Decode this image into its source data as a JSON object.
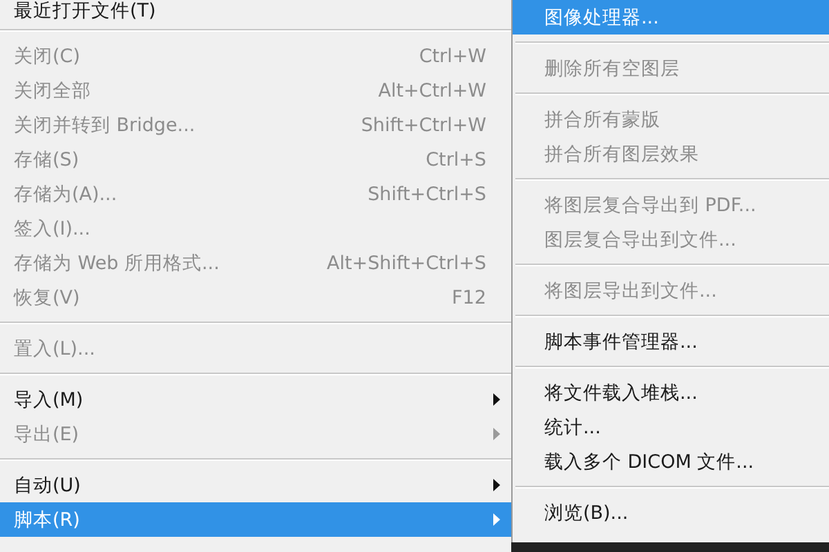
{
  "file_menu": {
    "items": [
      {
        "kind": "item",
        "label": "最近打开文件(T)",
        "disabled": false,
        "selected": false,
        "submenu": false
      },
      {
        "kind": "separator"
      },
      {
        "kind": "item",
        "label": "关闭(C)",
        "shortcut": "Ctrl+W",
        "disabled": true,
        "selected": false,
        "submenu": false
      },
      {
        "kind": "item",
        "label": "关闭全部",
        "shortcut": "Alt+Ctrl+W",
        "disabled": true,
        "selected": false,
        "submenu": false
      },
      {
        "kind": "item",
        "label": "关闭并转到 Bridge...",
        "shortcut": "Shift+Ctrl+W",
        "disabled": true,
        "selected": false,
        "submenu": false
      },
      {
        "kind": "item",
        "label": "存储(S)",
        "shortcut": "Ctrl+S",
        "disabled": true,
        "selected": false,
        "submenu": false
      },
      {
        "kind": "item",
        "label": "存储为(A)...",
        "shortcut": "Shift+Ctrl+S",
        "disabled": true,
        "selected": false,
        "submenu": false
      },
      {
        "kind": "item",
        "label": "签入(I)...",
        "disabled": true,
        "selected": false,
        "submenu": false
      },
      {
        "kind": "item",
        "label": "存储为 Web 所用格式...",
        "shortcut": "Alt+Shift+Ctrl+S",
        "disabled": true,
        "selected": false,
        "submenu": false
      },
      {
        "kind": "item",
        "label": "恢复(V)",
        "shortcut": "F12",
        "disabled": true,
        "selected": false,
        "submenu": false
      },
      {
        "kind": "separator"
      },
      {
        "kind": "item",
        "label": "置入(L)...",
        "disabled": true,
        "selected": false,
        "submenu": false
      },
      {
        "kind": "separator"
      },
      {
        "kind": "item",
        "label": "导入(M)",
        "disabled": false,
        "selected": false,
        "submenu": true
      },
      {
        "kind": "item",
        "label": "导出(E)",
        "disabled": true,
        "selected": false,
        "submenu": true
      },
      {
        "kind": "separator"
      },
      {
        "kind": "item",
        "label": "自动(U)",
        "disabled": false,
        "selected": false,
        "submenu": true
      },
      {
        "kind": "item",
        "label": "脚本(R)",
        "disabled": false,
        "selected": true,
        "submenu": true
      }
    ]
  },
  "scripts_submenu": {
    "items": [
      {
        "kind": "item",
        "label": "图像处理器...",
        "disabled": false,
        "selected": true
      },
      {
        "kind": "separator"
      },
      {
        "kind": "item",
        "label": "删除所有空图层",
        "disabled": true,
        "selected": false
      },
      {
        "kind": "separator"
      },
      {
        "kind": "item",
        "label": "拼合所有蒙版",
        "disabled": true,
        "selected": false
      },
      {
        "kind": "item",
        "label": "拼合所有图层效果",
        "disabled": true,
        "selected": false
      },
      {
        "kind": "separator"
      },
      {
        "kind": "item",
        "label": "将图层复合导出到 PDF...",
        "disabled": true,
        "selected": false
      },
      {
        "kind": "item",
        "label": "图层复合导出到文件...",
        "disabled": true,
        "selected": false
      },
      {
        "kind": "separator"
      },
      {
        "kind": "item",
        "label": "将图层导出到文件...",
        "disabled": true,
        "selected": false
      },
      {
        "kind": "separator"
      },
      {
        "kind": "item",
        "label": "脚本事件管理器...",
        "disabled": false,
        "selected": false
      },
      {
        "kind": "separator"
      },
      {
        "kind": "item",
        "label": "将文件载入堆栈...",
        "disabled": false,
        "selected": false
      },
      {
        "kind": "item",
        "label": "统计...",
        "disabled": false,
        "selected": false
      },
      {
        "kind": "item",
        "label": "载入多个 DICOM 文件...",
        "disabled": false,
        "selected": false
      },
      {
        "kind": "separator"
      },
      {
        "kind": "item",
        "label": "浏览(B)...",
        "disabled": false,
        "selected": false
      }
    ]
  }
}
